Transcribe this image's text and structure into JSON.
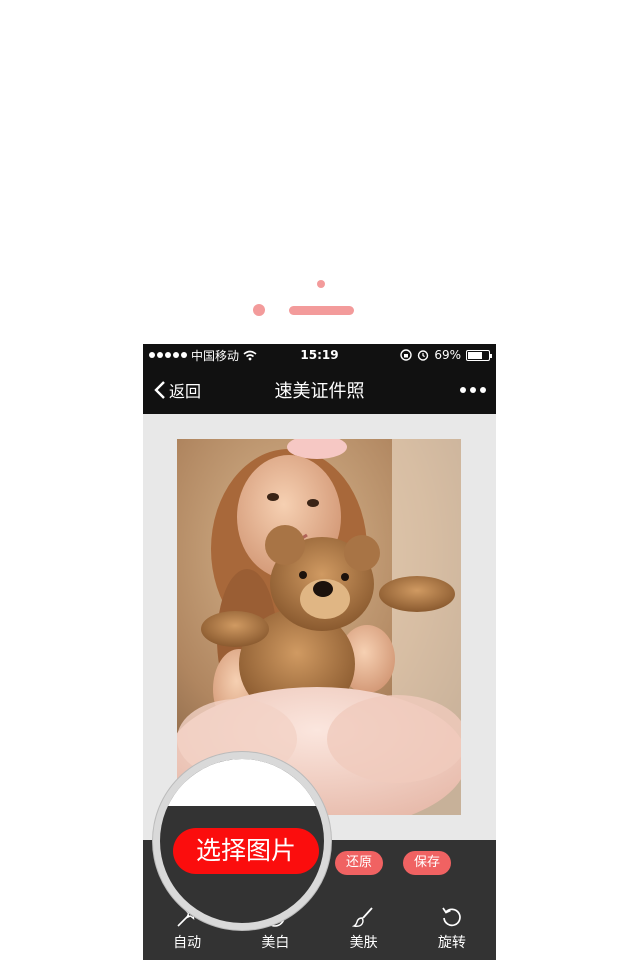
{
  "status_bar": {
    "carrier": "中国移动",
    "time": "15:19",
    "battery_text": "69%",
    "battery_level": 0.69
  },
  "nav": {
    "back_label": "返回",
    "title": "速美证件照"
  },
  "actions": {
    "restore_label": "还原",
    "save_label": "保存",
    "choose_label": "选择图片"
  },
  "tools": [
    {
      "label": "自动",
      "icon": "magic-wand-icon"
    },
    {
      "label": "美白",
      "icon": "face-icon"
    },
    {
      "label": "美肤",
      "icon": "brush-icon"
    },
    {
      "label": "旋转",
      "icon": "rotate-icon"
    }
  ],
  "colors": {
    "accent": "#f39b9b",
    "pill": "#f06262",
    "primary_button": "#fb0d0d",
    "bar_dark": "#111111",
    "toolbar": "#333333"
  }
}
